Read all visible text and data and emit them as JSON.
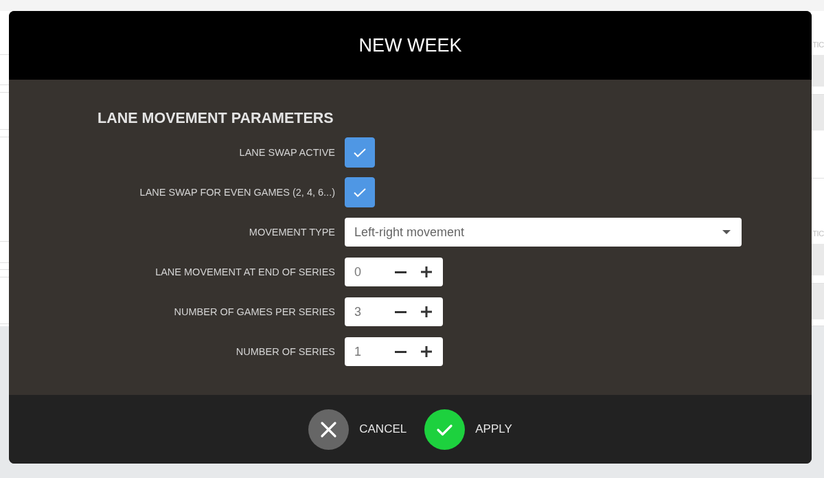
{
  "background_page": {
    "texts": [
      "TIC",
      "TIC"
    ]
  },
  "window": {
    "title": "NEW WEEK"
  },
  "section": {
    "title": "LANE MOVEMENT PARAMETERS"
  },
  "fields": [
    {
      "kind": "checkbox",
      "label": "LANE SWAP ACTIVE",
      "checked": true
    },
    {
      "kind": "checkbox",
      "label": "LANE SWAP FOR EVEN GAMES (2, 4, 6...)",
      "checked": true
    },
    {
      "kind": "select",
      "label": "MOVEMENT TYPE",
      "value": "Left-right movement"
    },
    {
      "kind": "stepper",
      "label": "LANE MOVEMENT AT END OF SERIES",
      "value": "0"
    },
    {
      "kind": "stepper",
      "label": "NUMBER OF GAMES PER SERIES",
      "value": "3"
    },
    {
      "kind": "stepper",
      "label": "NUMBER OF SERIES",
      "value": "1"
    }
  ],
  "buttons": [
    {
      "kind": "cancel",
      "label": "CANCEL"
    },
    {
      "kind": "apply",
      "label": "APPLY"
    }
  ]
}
